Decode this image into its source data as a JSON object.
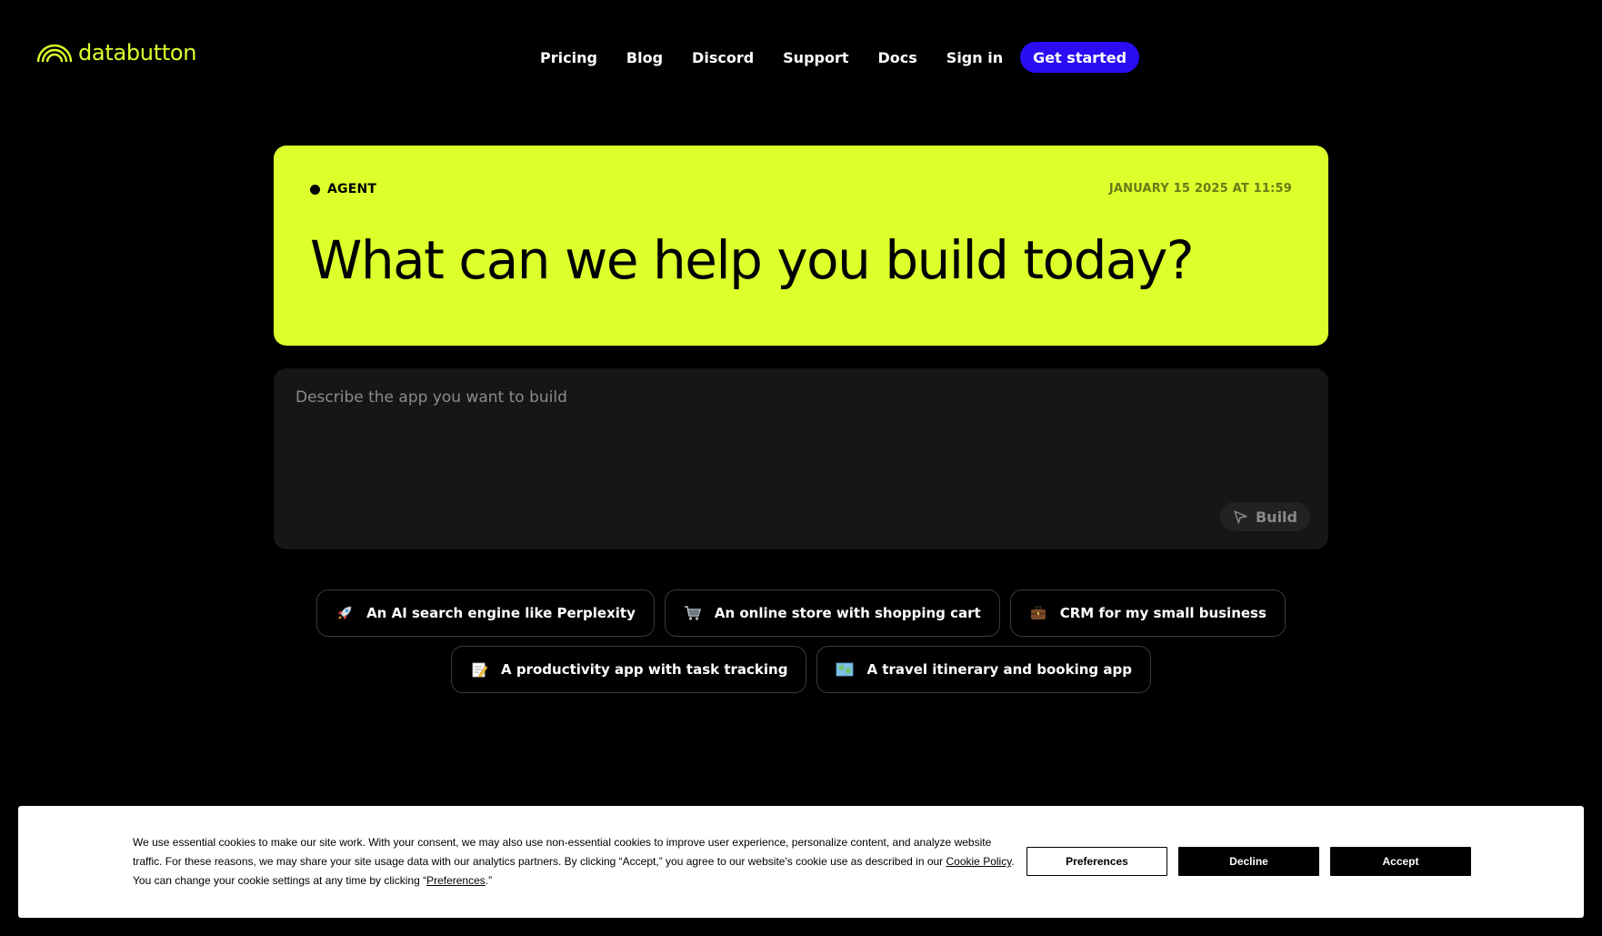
{
  "brand": {
    "name": "databutton",
    "accent": "#ddff2c",
    "primary_button": "#2a0cf5"
  },
  "nav": {
    "links": [
      "Pricing",
      "Blog",
      "Discord",
      "Support",
      "Docs",
      "Sign in"
    ],
    "cta": "Get started"
  },
  "hero": {
    "badge": "AGENT",
    "date": "JANUARY 15 2025 AT 11:59",
    "title": "What can we help you build today?"
  },
  "prompt": {
    "placeholder": "Describe the app you want to build",
    "value": "",
    "button": "Build",
    "button_icon": "send-icon"
  },
  "suggestions": [
    {
      "icon": "rocket-icon",
      "label": "An AI search engine like Perplexity"
    },
    {
      "icon": "shopping-cart-icon",
      "label": "An online store with shopping cart"
    },
    {
      "icon": "briefcase-icon",
      "label": "CRM for my small business"
    },
    {
      "icon": "memo-icon",
      "label": "A productivity app with task tracking"
    },
    {
      "icon": "map-icon",
      "label": "A travel itinerary and booking app"
    }
  ],
  "cookie": {
    "text_1": "We use essential cookies to make our site work. With your consent, we may also use non-essential cookies to improve user experience, personalize content, and analyze website traffic. For these reasons, we may share your site usage data with our analytics partners. By clicking “Accept,” you agree to our website's cookie use as described in our ",
    "link_policy": "Cookie Policy",
    "text_2": ". You can change your cookie settings at any time by clicking “",
    "link_prefs": "Preferences",
    "text_3": ".”",
    "buttons": {
      "preferences": "Preferences",
      "decline": "Decline",
      "accept": "Accept"
    }
  }
}
